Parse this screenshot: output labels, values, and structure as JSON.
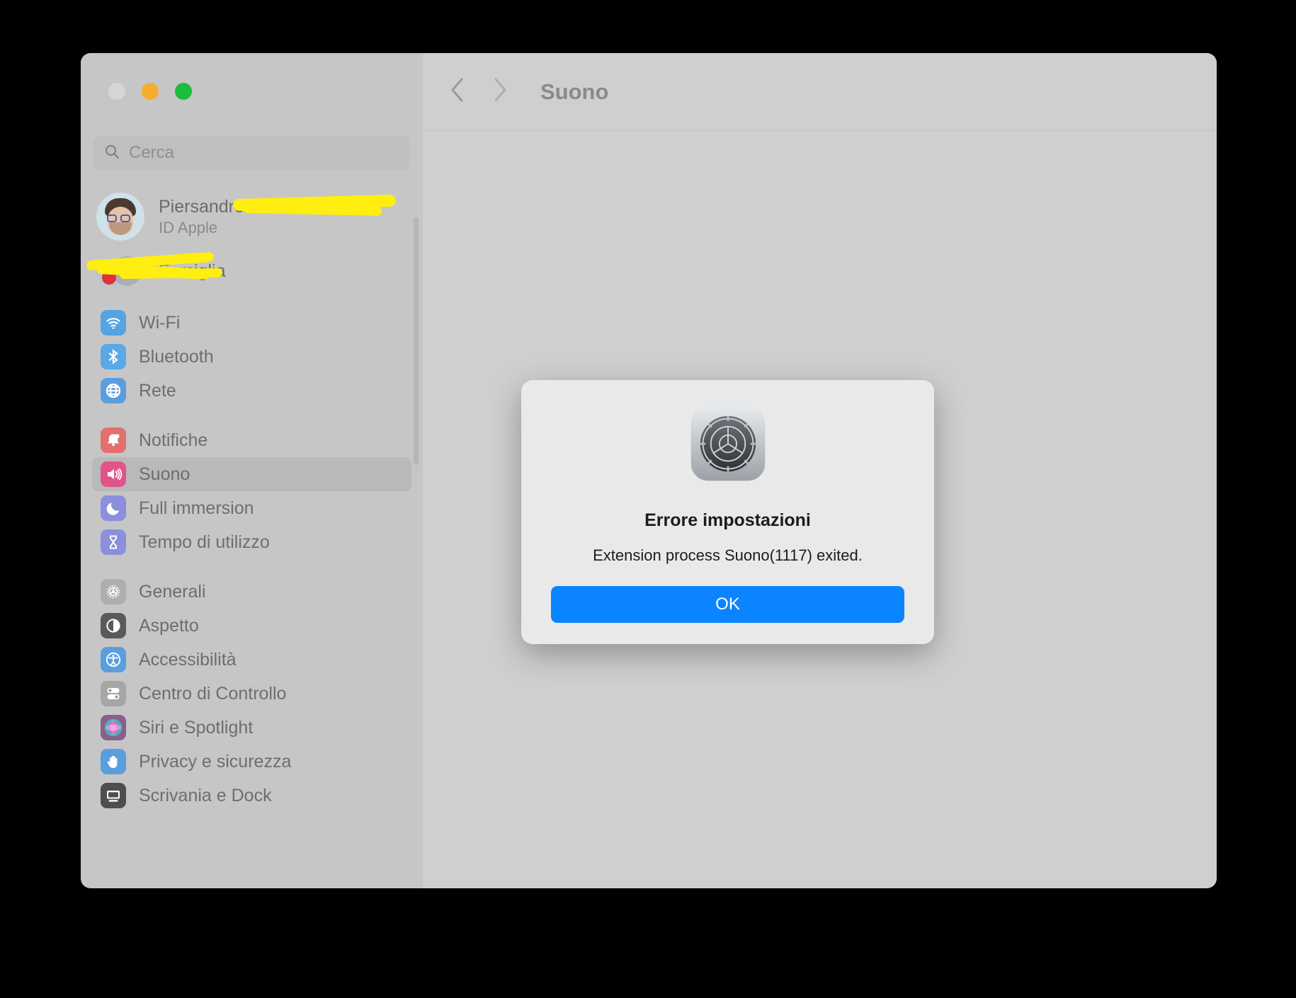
{
  "window": {
    "traffic_lights": [
      "close",
      "minimize",
      "maximize"
    ]
  },
  "search": {
    "placeholder": "Cerca",
    "value": "",
    "icon": "search-icon"
  },
  "account": {
    "name": "Piersandro",
    "subtitle": "ID Apple",
    "avatar_icon": "memoji-avatar",
    "redacted": true
  },
  "family": {
    "label": "Famiglia",
    "redacted": true
  },
  "sidebar": {
    "groups": [
      {
        "items": [
          {
            "label": "Wi-Fi",
            "icon": "wifi-icon",
            "color": "#55a3e0",
            "selected": false
          },
          {
            "label": "Bluetooth",
            "icon": "bluetooth-icon",
            "color": "#5aa8e6",
            "selected": false
          },
          {
            "label": "Rete",
            "icon": "globe-icon",
            "color": "#5b9ede",
            "selected": false
          }
        ]
      },
      {
        "items": [
          {
            "label": "Notifiche",
            "icon": "bell-icon",
            "color": "#e2706e",
            "selected": false
          },
          {
            "label": "Suono",
            "icon": "speaker-icon",
            "color": "#e0548a",
            "selected": true
          },
          {
            "label": "Full immersion",
            "icon": "moon-icon",
            "color": "#8b8fdd",
            "selected": false
          },
          {
            "label": "Tempo di utilizzo",
            "icon": "hourglass-icon",
            "color": "#8b8fdd",
            "selected": false
          }
        ]
      },
      {
        "items": [
          {
            "label": "Generali",
            "icon": "gear-icon",
            "color": "#aeaeae",
            "selected": false
          },
          {
            "label": "Aspetto",
            "icon": "appearance-icon",
            "color": "#5a5a5a",
            "selected": false
          },
          {
            "label": "Accessibilità",
            "icon": "accessibility-icon",
            "color": "#5b9ede",
            "selected": false
          },
          {
            "label": "Centro di Controllo",
            "icon": "switches-icon",
            "color": "#a6a6a6",
            "selected": false
          },
          {
            "label": "Siri e Spotlight",
            "icon": "siri-icon",
            "color": "#8a5f8e",
            "selected": false
          },
          {
            "label": "Privacy e sicurezza",
            "icon": "hand-icon",
            "color": "#5b9ede",
            "selected": false
          },
          {
            "label": "Scrivania e Dock",
            "icon": "desktop-dock-icon",
            "color": "#4e4e4e",
            "selected": false
          }
        ]
      }
    ]
  },
  "toolbar": {
    "back_icon": "chevron-left-icon",
    "forward_icon": "chevron-right-icon",
    "title": "Suono"
  },
  "dialog": {
    "app_icon": "system-settings-gear-icon",
    "title": "Errore impostazioni",
    "message": "Extension process Suono(1117) exited.",
    "ok_label": "OK",
    "accent_color": "#0a84ff"
  }
}
